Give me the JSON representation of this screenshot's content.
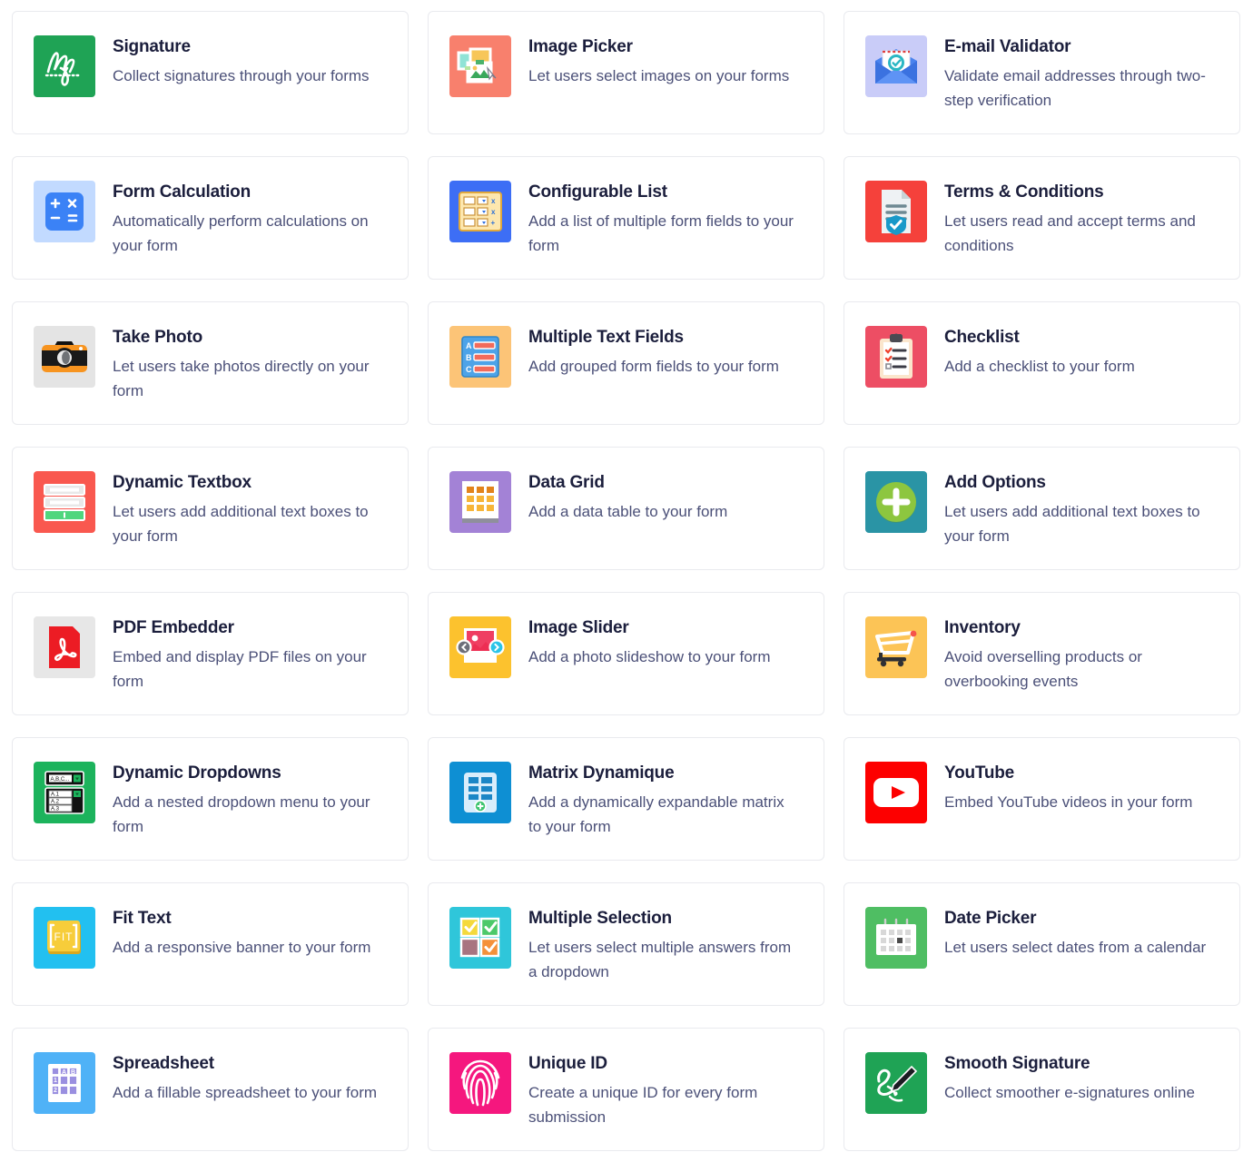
{
  "page": {
    "kind": "widget-gallery",
    "columns": 3,
    "card_background": "#ffffff",
    "card_border_color": "#e9eaee",
    "title_color": "#1b1e3c",
    "description_color": "#4b5078"
  },
  "widgets": [
    {
      "title": "Signature",
      "description": "Collect signatures through your forms",
      "icon": "signature-script-icon",
      "icon_bg": "#1fa355",
      "icon_fg": "#ffffff"
    },
    {
      "title": "Image Picker",
      "description": "Let users select images on your forms",
      "icon": "photo-stack-cursor-icon",
      "icon_bg": "#f8806d",
      "icon_fg": "#ffffff"
    },
    {
      "title": "E-mail Validator",
      "description": "Validate email addresses through two-step verification",
      "icon": "envelope-check-icon",
      "icon_bg": "#c9ccf8",
      "icon_fg": "#3b6fe0"
    },
    {
      "title": "Form Calculation",
      "description": "Automatically perform calculations on your form",
      "icon": "calculator-icon",
      "icon_bg": "#c2daff",
      "icon_fg": "#3b82f6"
    },
    {
      "title": "Configurable List",
      "description": "Add a list of multiple form fields to your form",
      "icon": "configurable-grid-icon",
      "icon_bg": "#3d6ef5",
      "icon_fg": "#fde7ae"
    },
    {
      "title": "Terms & Conditions",
      "description": "Let users read and accept terms and conditions",
      "icon": "document-approved-icon",
      "icon_bg": "#f5413b",
      "icon_fg": "#eef2f4"
    },
    {
      "title": "Take Photo",
      "description": "Let users take photos directly on your form",
      "icon": "camera-icon",
      "icon_bg": "#e4e4e4",
      "icon_fg": "#f79420"
    },
    {
      "title": "Multiple Text Fields",
      "description": "Add grouped form fields to your form",
      "icon": "abc-text-fields-icon",
      "icon_bg": "#fcc477",
      "icon_fg": "#4da3e8"
    },
    {
      "title": "Checklist",
      "description": "Add a checklist to your form",
      "icon": "clipboard-checklist-icon",
      "icon_bg": "#ed4e64",
      "icon_fg": "#fbe6cd"
    },
    {
      "title": "Dynamic Textbox",
      "description": "Let users add additional text boxes to your form",
      "icon": "stacked-textboxes-icon",
      "icon_bg": "#f9584f",
      "icon_fg": "#e8e8e8"
    },
    {
      "title": "Data Grid",
      "description": "Add a data table to your form",
      "icon": "data-table-icon",
      "icon_bg": "#a382d6",
      "icon_fg": "#f7b538"
    },
    {
      "title": "Add Options",
      "description": "Let users add additional text boxes to your form",
      "icon": "plus-circle-icon",
      "icon_bg": "#2a94a5",
      "icon_fg": "#8dc63f"
    },
    {
      "title": "PDF Embedder",
      "description": "Embed and display PDF files on your form",
      "icon": "pdf-file-icon",
      "icon_bg": "#e7e7e7",
      "icon_fg": "#ec1c24"
    },
    {
      "title": "Image Slider",
      "description": "Add a photo slideshow to your form",
      "icon": "image-carousel-arrows-icon",
      "icon_bg": "#fcc22e",
      "icon_fg": "#ef3e62"
    },
    {
      "title": "Inventory",
      "description": "Avoid overselling products or overbooking events",
      "icon": "shopping-cart-icon",
      "icon_bg": "#fcc456",
      "icon_fg": "#ffffff"
    },
    {
      "title": "Dynamic Dropdowns",
      "description": "Add a nested dropdown menu to your form",
      "icon": "nested-dropdown-icon",
      "icon_bg": "#1cb35c",
      "icon_fg": "#111111"
    },
    {
      "title": "Matrix Dynamique",
      "description": "Add a dynamically expandable matrix to your form",
      "icon": "matrix-expand-icon",
      "icon_bg": "#0e8fd3",
      "icon_fg": "#d9edfb"
    },
    {
      "title": "YouTube",
      "description": "Embed YouTube videos in your form",
      "icon": "youtube-play-icon",
      "icon_bg": "#fd0000",
      "icon_fg": "#ffffff"
    },
    {
      "title": "Fit Text",
      "description": "Add a responsive banner to your form",
      "icon": "fit-text-bracket-icon",
      "icon_bg": "#22c0f0",
      "icon_fg": "#f7cd3a"
    },
    {
      "title": "Multiple Selection",
      "description": "Let users select multiple answers from a dropdown",
      "icon": "multi-checkbox-icon",
      "icon_bg": "#2fc6da",
      "icon_fg": "#ffffff"
    },
    {
      "title": "Date Picker",
      "description": "Let users select dates from a calendar",
      "icon": "calendar-icon",
      "icon_bg": "#4fbe63",
      "icon_fg": "#ffffff"
    },
    {
      "title": "Spreadsheet",
      "description": "Add a fillable spreadsheet to your form",
      "icon": "spreadsheet-cells-icon",
      "icon_bg": "#4fb2f7",
      "icon_fg": "#9a8fe0"
    },
    {
      "title": "Unique ID",
      "description": "Create a unique ID for every form submission",
      "icon": "fingerprint-icon",
      "icon_bg": "#f5177e",
      "icon_fg": "#ffffff"
    },
    {
      "title": "Smooth Signature",
      "description": "Collect smoother e-signatures online",
      "icon": "fountain-pen-signature-icon",
      "icon_bg": "#1fa355",
      "icon_fg": "#111111"
    }
  ]
}
